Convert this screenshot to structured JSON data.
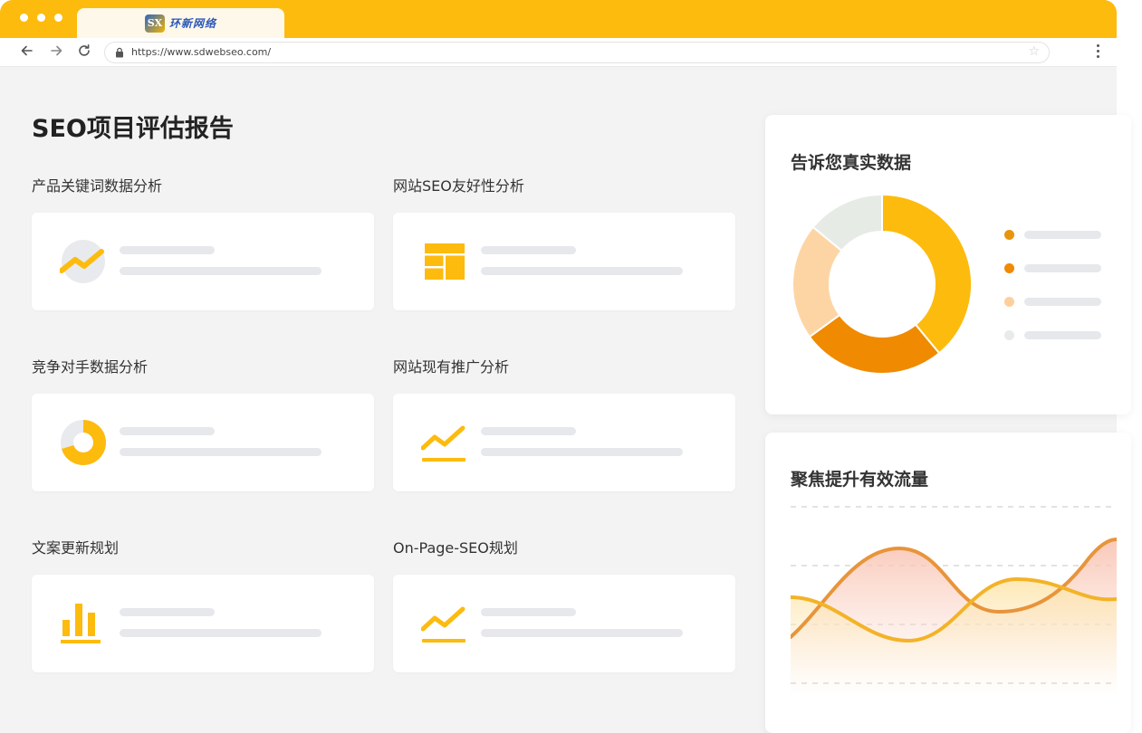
{
  "browser": {
    "tab": {
      "logo_mark": "SX",
      "logo_text": "环新网络"
    },
    "url": "https://www.sdwebseo.com/"
  },
  "page": {
    "title": "SEO项目评估报告",
    "sections": [
      {
        "label": "产品关键词数据分析",
        "icon": "trend-line-in-circle-icon"
      },
      {
        "label": "网站SEO友好性分析",
        "icon": "grid-layout-icon"
      },
      {
        "label": "竞争对手数据分析",
        "icon": "donut-chart-icon"
      },
      {
        "label": "网站现有推广分析",
        "icon": "trend-line-icon"
      },
      {
        "label": "文案更新规划",
        "icon": "bar-chart-icon"
      },
      {
        "label": "On-Page-SEO规划",
        "icon": "trend-line-icon"
      }
    ]
  },
  "panels": {
    "donut": {
      "title": "告诉您真实数据",
      "segments": [
        {
          "value": 0.39,
          "color": "#fdbb0e"
        },
        {
          "value": 0.26,
          "color": "#f08a00"
        },
        {
          "value": 0.21,
          "color": "#fdd5a4"
        },
        {
          "value": 0.14,
          "color": "#e6ebe6"
        }
      ],
      "legend_colors": [
        "#e8950c",
        "#f08a00",
        "#fdcf9c",
        "#e8ece8"
      ]
    },
    "wave": {
      "title": "聚焦提升有效流量",
      "colors": {
        "wave_a": "#e8943a",
        "wave_b": "#f3b328",
        "fill_a": "#f9c9b4",
        "fill_b": "#fde9b8",
        "grid": "#e2e2e2"
      }
    }
  }
}
